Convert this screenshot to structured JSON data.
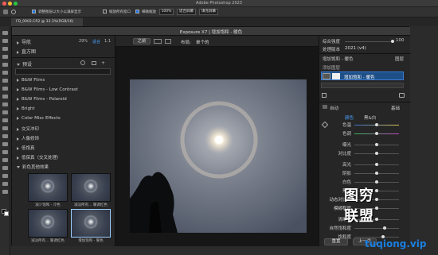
{
  "ps": {
    "title": "Adobe Photoshop 2023",
    "tab": "FD_0002.CR2 @ 33.3%(RGB/16)",
    "options": {
      "opt1": "调整图层以大小以满屏显示",
      "opt2": "缩放所有窗口",
      "opt3": "细微缩放",
      "zoom": "100%",
      "fit": "适合屏幕",
      "fill": "填充屏幕"
    }
  },
  "exp": {
    "title": "Exposure X7 | 增加饱和 - 暖色",
    "nav": {
      "label": "导航",
      "pct": "29%",
      "fit": "适合",
      "ratio": "1:1"
    },
    "histogram": "直方图",
    "presets": {
      "label": "预设",
      "groups": [
        "B&W Films",
        "B&W Films - Low Contrast",
        "B&W Films - Polaroid",
        "Bright",
        "Color Misc Effects",
        "交叉冲印",
        "人像修饰",
        "低饱真",
        "低保真（交叉处理）",
        "彩色其他效果"
      ],
      "thumbs": [
        "减少饱和 - 冷色",
        "减淡所有... 暖调红色",
        "减淡所有... 暖调红色",
        "增加饱和 - 暖色"
      ]
    },
    "toolbar": {
      "before_after": "之前",
      "layout": "布局:",
      "layout_val": "单个的"
    },
    "right": {
      "strength_label": "综合强度",
      "strength_val": "100",
      "version_label": "处理版本",
      "version_val": "2021 (v4)",
      "layer_name": "增加饱和 - 暖色",
      "layers": "图层",
      "add_layer": "添加图层",
      "layer_item": "增加饱和 - 暖色",
      "auto": "自动",
      "basic": "基础",
      "color": "颜色",
      "bw": "黑&白",
      "sliders": [
        "色温",
        "色调",
        "曝光",
        "对比度",
        "高光",
        "阴影",
        "白色",
        "黑色",
        "动态对比度",
        "模糊程度",
        "清晰度",
        "自然饱和度",
        "饱和度"
      ],
      "reset": "重置",
      "copy": "上一个"
    }
  },
  "watermark": {
    "top": "图穷\n联盟",
    "line1": "图穷",
    "line2": "联盟",
    "url": "tuqiong.vip"
  }
}
